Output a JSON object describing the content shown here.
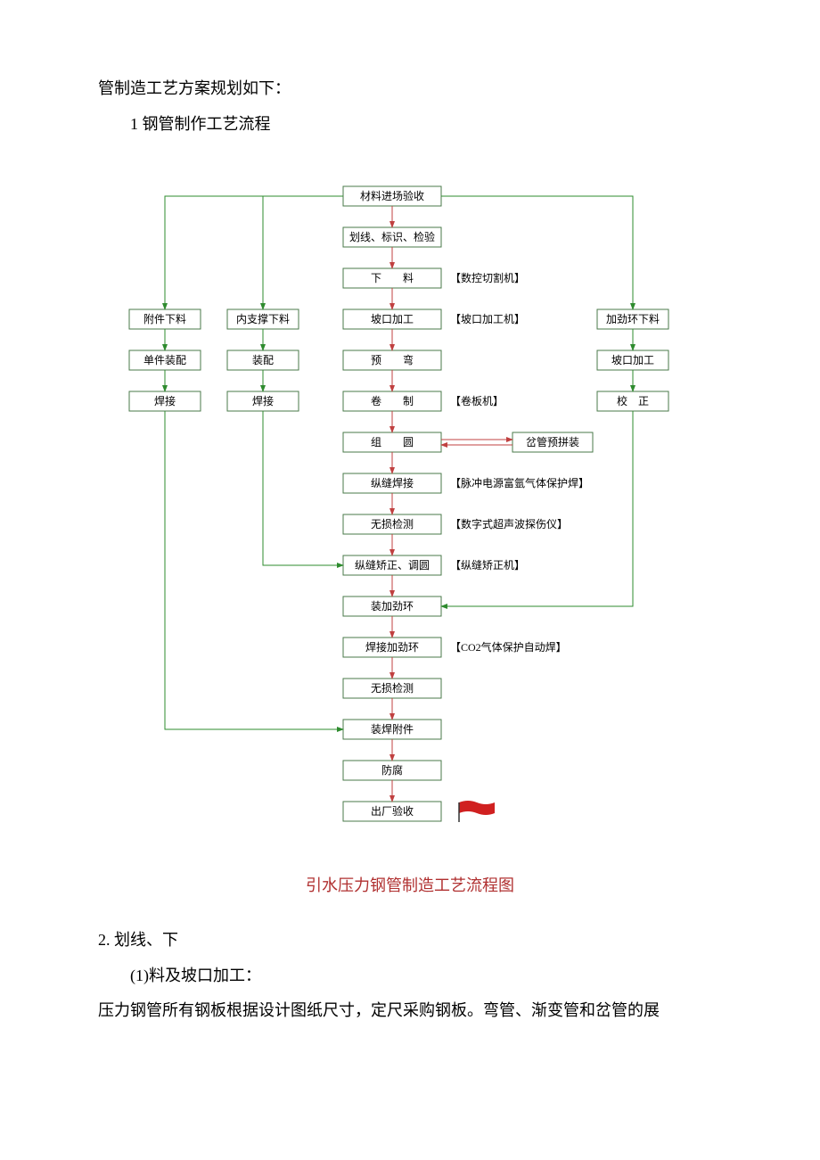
{
  "intro": {
    "line1": "管制造工艺方案规划如下：",
    "line2": "1 钢管制作工艺流程"
  },
  "flow": {
    "main": [
      "材料进场验收",
      "划线、标识、检验",
      "下　　料",
      "坡口加工",
      "预　　弯",
      "卷　　制",
      "组　　圆",
      "纵缝焊接",
      "无损检测",
      "纵缝矫正、调圆",
      "装加劲环",
      "焊接加劲环",
      "无损检测",
      "装焊附件",
      "防腐",
      "出厂验收"
    ],
    "notes": {
      "2": "【数控切割机】",
      "3": "【坡口加工机】",
      "5": "【卷板机】",
      "7": "【脉冲电源富氩气体保护焊】",
      "8": "【数字式超声波探伤仪】",
      "9": "【纵缝矫正机】",
      "11": "【CO2气体保护自动焊】"
    },
    "left1": [
      "附件下料",
      "单件装配",
      "焊接"
    ],
    "left2": [
      "内支撑下料",
      "装配",
      "焊接"
    ],
    "right": [
      "加劲环下料",
      "坡口加工",
      "校　正"
    ],
    "branch": "岔管预拼装"
  },
  "caption": "引水压力钢管制造工艺流程图",
  "body": {
    "s2": "2. 划线、下",
    "s2a": "(1)料及坡口加工：",
    "s2b": "压力钢管所有钢板根据设计图纸尺寸，定尺采购钢板。弯管、渐变管和岔管的展"
  },
  "chart_data": {
    "type": "flowchart",
    "title": "引水压力钢管制造工艺流程图",
    "nodes": [
      {
        "id": "m0",
        "label": "材料进场验收"
      },
      {
        "id": "m1",
        "label": "划线、标识、检验"
      },
      {
        "id": "m2",
        "label": "下料",
        "note": "数控切割机"
      },
      {
        "id": "m3",
        "label": "坡口加工",
        "note": "坡口加工机"
      },
      {
        "id": "m4",
        "label": "预弯"
      },
      {
        "id": "m5",
        "label": "卷制",
        "note": "卷板机"
      },
      {
        "id": "m6",
        "label": "组圆"
      },
      {
        "id": "m7",
        "label": "纵缝焊接",
        "note": "脉冲电源富氩气体保护焊"
      },
      {
        "id": "m8",
        "label": "无损检测",
        "note": "数字式超声波探伤仪"
      },
      {
        "id": "m9",
        "label": "纵缝矫正、调圆",
        "note": "纵缝矫正机"
      },
      {
        "id": "m10",
        "label": "装加劲环"
      },
      {
        "id": "m11",
        "label": "焊接加劲环",
        "note": "CO2气体保护自动焊"
      },
      {
        "id": "m12",
        "label": "无损检测"
      },
      {
        "id": "m13",
        "label": "装焊附件"
      },
      {
        "id": "m14",
        "label": "防腐"
      },
      {
        "id": "m15",
        "label": "出厂验收"
      },
      {
        "id": "l1a",
        "label": "附件下料"
      },
      {
        "id": "l1b",
        "label": "单件装配"
      },
      {
        "id": "l1c",
        "label": "焊接"
      },
      {
        "id": "l2a",
        "label": "内支撑下料"
      },
      {
        "id": "l2b",
        "label": "装配"
      },
      {
        "id": "l2c",
        "label": "焊接"
      },
      {
        "id": "r1",
        "label": "加劲环下料"
      },
      {
        "id": "r2",
        "label": "坡口加工"
      },
      {
        "id": "r3",
        "label": "校正"
      },
      {
        "id": "b1",
        "label": "岔管预拼装"
      }
    ],
    "edges": [
      [
        "m0",
        "m1"
      ],
      [
        "m1",
        "m2"
      ],
      [
        "m2",
        "m3"
      ],
      [
        "m3",
        "m4"
      ],
      [
        "m4",
        "m5"
      ],
      [
        "m5",
        "m6"
      ],
      [
        "m6",
        "m7"
      ],
      [
        "m7",
        "m8"
      ],
      [
        "m8",
        "m9"
      ],
      [
        "m9",
        "m10"
      ],
      [
        "m10",
        "m11"
      ],
      [
        "m11",
        "m12"
      ],
      [
        "m12",
        "m13"
      ],
      [
        "m13",
        "m14"
      ],
      [
        "m14",
        "m15"
      ],
      [
        "m0",
        "l1a"
      ],
      [
        "l1a",
        "l1b"
      ],
      [
        "l1b",
        "l1c"
      ],
      [
        "l1c",
        "m13"
      ],
      [
        "m0",
        "l2a"
      ],
      [
        "l2a",
        "l2b"
      ],
      [
        "l2b",
        "l2c"
      ],
      [
        "l2c",
        "m9"
      ],
      [
        "m0",
        "r1"
      ],
      [
        "r1",
        "r2"
      ],
      [
        "r2",
        "r3"
      ],
      [
        "r3",
        "m10"
      ],
      [
        "m6",
        "b1"
      ],
      [
        "b1",
        "m6"
      ]
    ]
  }
}
